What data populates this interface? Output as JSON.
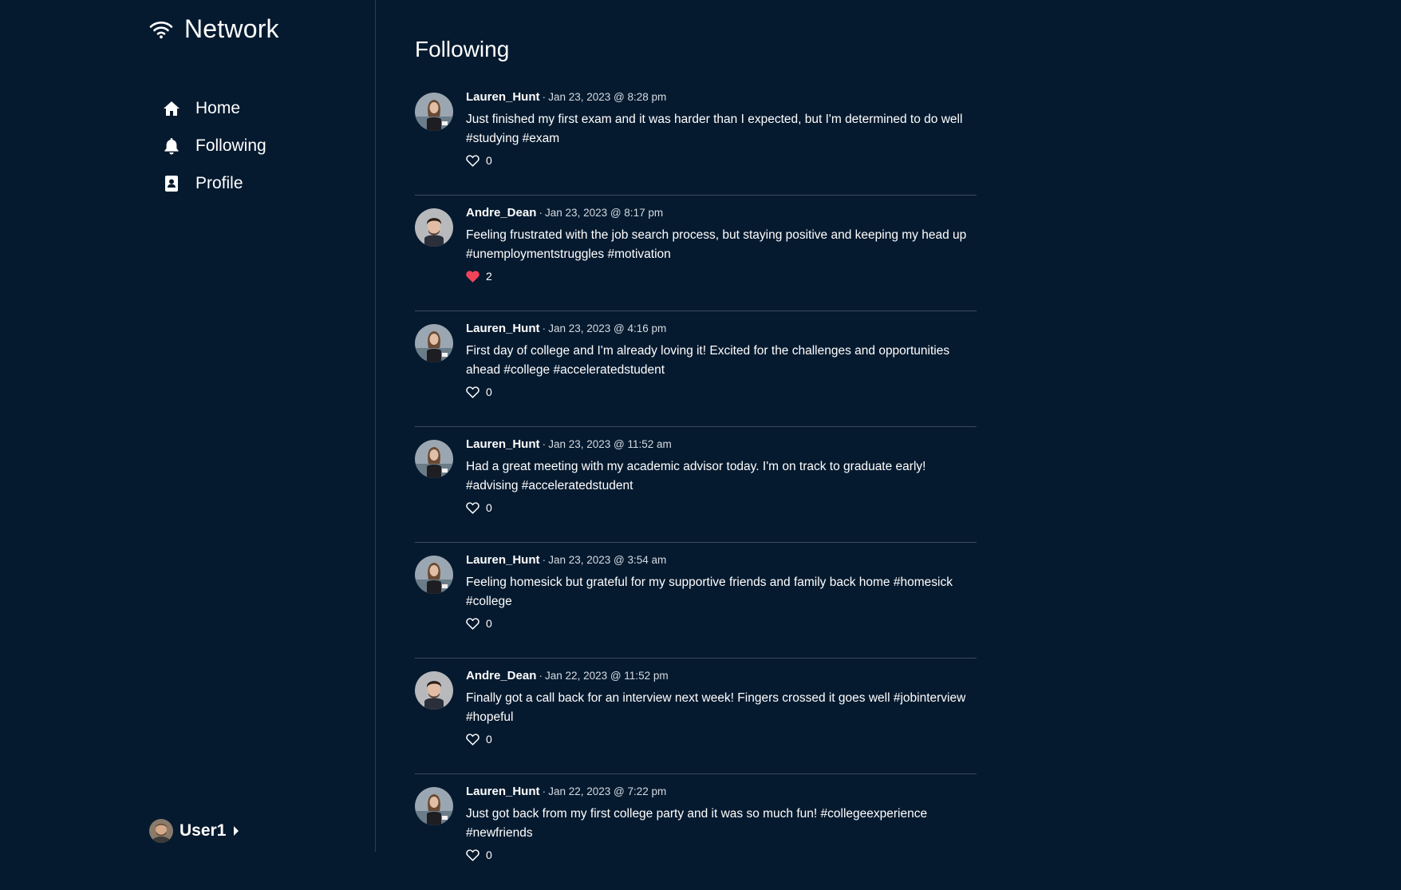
{
  "sidebar": {
    "brand": {
      "title": "Network",
      "icon": "wifi-icon"
    },
    "nav": [
      {
        "label": "Home",
        "icon": "home-icon"
      },
      {
        "label": "Following",
        "icon": "bell-icon"
      },
      {
        "label": "Profile",
        "icon": "contact-card-icon"
      }
    ],
    "user": {
      "name": "User1",
      "icon": "caret-right-icon"
    }
  },
  "main": {
    "title": "Following",
    "posts": [
      {
        "user": "Lauren_Hunt",
        "time": "Jan 23, 2023 @ 8:28 pm",
        "text": "Just finished my first exam and it was harder than I expected, but I'm determined to do well #studying #exam",
        "likes": "0",
        "liked": false
      },
      {
        "user": "Andre_Dean",
        "time": "Jan 23, 2023 @ 8:17 pm",
        "text": "Feeling frustrated with the job search process, but staying positive and keeping my head up #unemploymentstruggles #motivation",
        "likes": "2",
        "liked": true
      },
      {
        "user": "Lauren_Hunt",
        "time": "Jan 23, 2023 @ 4:16 pm",
        "text": "First day of college and I'm already loving it! Excited for the challenges and opportunities ahead #college #acceleratedstudent",
        "likes": "0",
        "liked": false
      },
      {
        "user": "Lauren_Hunt",
        "time": "Jan 23, 2023 @ 11:52 am",
        "text": "Had a great meeting with my academic advisor today. I'm on track to graduate early! #advising #acceleratedstudent",
        "likes": "0",
        "liked": false
      },
      {
        "user": "Lauren_Hunt",
        "time": "Jan 23, 2023 @ 3:54 am",
        "text": "Feeling homesick but grateful for my supportive friends and family back home #homesick #college",
        "likes": "0",
        "liked": false
      },
      {
        "user": "Andre_Dean",
        "time": "Jan 22, 2023 @ 11:52 pm",
        "text": "Finally got a call back for an interview next week! Fingers crossed it goes well #jobinterview #hopeful",
        "likes": "0",
        "liked": false
      },
      {
        "user": "Lauren_Hunt",
        "time": "Jan 22, 2023 @ 7:22 pm",
        "text": "Just got back from my first college party and it was so much fun! #collegeexperience #newfriends",
        "likes": "0",
        "liked": false
      }
    ]
  },
  "colors": {
    "background": "#061a2f",
    "divider": "#3a4a5c",
    "like_active": "#f0435a"
  }
}
